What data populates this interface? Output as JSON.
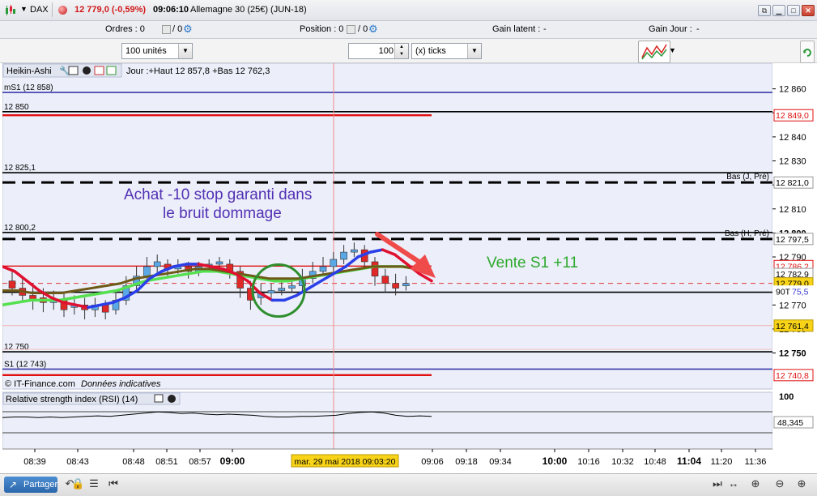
{
  "titlebar": {
    "symbol": "DAX",
    "price": "12 779,0 (-0,59%)",
    "time": "09:06:10",
    "instrument": "Allemagne 30 (25€) (JUN-18)"
  },
  "infobar": {
    "orders_label": "Ordres : 0",
    "orders_slash": "/ 0",
    "position_label": "Position : 0",
    "position_slash": "/ 0",
    "latent_label": "Gain latent :",
    "latent_value": "-",
    "day_label": "Gain Jour :",
    "day_value": "-"
  },
  "controls": {
    "quantity_value": "100 unités",
    "ticks_value": "100",
    "ticks_unit": "(x) ticks"
  },
  "panel_header": {
    "title": "Heikin-Ashi",
    "info": "Jour :+Haut 12 857,8 +Bas 12 762,3"
  },
  "chart_data": {
    "type": "candlestick",
    "ylim": [
      12735,
      12870
    ],
    "y_ticks": [
      "12 860",
      "12 850",
      "12 840",
      "12 830",
      "12 820",
      "12 810",
      "12 800",
      "12 790",
      "12 770",
      "12 760",
      "12 750"
    ],
    "level_lines": [
      {
        "label": "mS1 (12 858)",
        "value": 12858.5,
        "color": "#3a3aa8",
        "dash": false
      },
      {
        "label": "12 850",
        "value": 12850.5,
        "color": "#000000",
        "dash": false
      },
      {
        "label": "12 825,1",
        "value": 12825.1,
        "color": "#000000",
        "dash": false
      },
      {
        "label": "12 800,2",
        "value": 12800.2,
        "color": "#000000",
        "dash": false
      },
      {
        "label": "12 750",
        "value": 12750.5,
        "color": "#000000",
        "dash": false
      },
      {
        "label": "S1 (12 743)",
        "value": 12743.3,
        "color": "#3a3aa8",
        "dash": false
      },
      {
        "label": "",
        "value": 12821.0,
        "color": "#000000",
        "dash": true
      },
      {
        "label": "",
        "value": 12797.5,
        "color": "#000000",
        "dash": true
      },
      {
        "label": "",
        "value": 12775.3,
        "color": "#000000",
        "dash": false
      }
    ],
    "right_labels": [
      {
        "text": "Bas (J, Pré)",
        "value": 12821.0
      },
      {
        "text": "Bas (H, Pré)",
        "value": 12797.5
      }
    ],
    "price_tags": [
      {
        "text": "12 849,0",
        "value": 12849.0,
        "style": "red"
      },
      {
        "text": "12 821,0",
        "value": 12821.0,
        "style": "grey"
      },
      {
        "text": "12 797,5",
        "value": 12797.5,
        "style": "grey"
      },
      {
        "text": "12 786,2",
        "value": 12786.2,
        "style": "red"
      },
      {
        "text": "12 782,9",
        "value": 12782.9,
        "style": "grey"
      },
      {
        "text": "12 779,0",
        "value": 12779.0,
        "style": "yellow"
      },
      {
        "text": "90T",
        "value": 12775.6,
        "style": "blue"
      },
      {
        "text": "75,5",
        "value": 12775.6,
        "style": "blueval"
      },
      {
        "text": "12 761,4",
        "value": 12761.4,
        "style": "yellow"
      },
      {
        "text": "12 740,8",
        "value": 12740.8,
        "style": "red"
      }
    ],
    "candles": [
      {
        "o": 12780,
        "c": 12777,
        "h": 12784,
        "l": 12774
      },
      {
        "o": 12777,
        "c": 12774,
        "h": 12781,
        "l": 12771
      },
      {
        "o": 12774,
        "c": 12772,
        "h": 12779,
        "l": 12768
      },
      {
        "o": 12773,
        "c": 12771,
        "h": 12777,
        "l": 12767
      },
      {
        "o": 12771,
        "c": 12772,
        "h": 12776,
        "l": 12768
      },
      {
        "o": 12772,
        "c": 12768,
        "h": 12775,
        "l": 12765
      },
      {
        "o": 12769,
        "c": 12770,
        "h": 12774,
        "l": 12766
      },
      {
        "o": 12770,
        "c": 12768,
        "h": 12773,
        "l": 12764
      },
      {
        "o": 12768,
        "c": 12770,
        "h": 12773,
        "l": 12765
      },
      {
        "o": 12770,
        "c": 12767,
        "h": 12772,
        "l": 12764
      },
      {
        "o": 12768,
        "c": 12772,
        "h": 12776,
        "l": 12766
      },
      {
        "o": 12772,
        "c": 12778,
        "h": 12782,
        "l": 12770
      },
      {
        "o": 12778,
        "c": 12782,
        "h": 12786,
        "l": 12776
      },
      {
        "o": 12782,
        "c": 12786,
        "h": 12790,
        "l": 12780
      },
      {
        "o": 12786,
        "c": 12788,
        "h": 12791,
        "l": 12783
      },
      {
        "o": 12787,
        "c": 12785,
        "h": 12789,
        "l": 12782
      },
      {
        "o": 12785,
        "c": 12786,
        "h": 12789,
        "l": 12783
      },
      {
        "o": 12786,
        "c": 12784,
        "h": 12788,
        "l": 12781
      },
      {
        "o": 12784,
        "c": 12786,
        "h": 12788,
        "l": 12782
      },
      {
        "o": 12786,
        "c": 12787,
        "h": 12789,
        "l": 12784
      },
      {
        "o": 12787,
        "c": 12788,
        "h": 12790,
        "l": 12785
      },
      {
        "o": 12787,
        "c": 12784,
        "h": 12789,
        "l": 12781
      },
      {
        "o": 12784,
        "c": 12777,
        "h": 12786,
        "l": 12773
      },
      {
        "o": 12777,
        "c": 12772,
        "h": 12780,
        "l": 12768
      },
      {
        "o": 12773,
        "c": 12775,
        "h": 12779,
        "l": 12770
      },
      {
        "o": 12775,
        "c": 12776,
        "h": 12779,
        "l": 12773
      },
      {
        "o": 12776,
        "c": 12777,
        "h": 12780,
        "l": 12774
      },
      {
        "o": 12777,
        "c": 12778,
        "h": 12781,
        "l": 12775
      },
      {
        "o": 12778,
        "c": 12781,
        "h": 12785,
        "l": 12776
      },
      {
        "o": 12781,
        "c": 12784,
        "h": 12788,
        "l": 12779
      },
      {
        "o": 12784,
        "c": 12786,
        "h": 12790,
        "l": 12782
      },
      {
        "o": 12786,
        "c": 12789,
        "h": 12792,
        "l": 12784
      },
      {
        "o": 12789,
        "c": 12792,
        "h": 12795,
        "l": 12787
      },
      {
        "o": 12792,
        "c": 12793,
        "h": 12796,
        "l": 12790
      },
      {
        "o": 12793,
        "c": 12788,
        "h": 12795,
        "l": 12785
      },
      {
        "o": 12788,
        "c": 12782,
        "h": 12790,
        "l": 12778
      },
      {
        "o": 12782,
        "c": 12779,
        "h": 12785,
        "l": 12775
      },
      {
        "o": 12779,
        "c": 12777,
        "h": 12783,
        "l": 12774
      },
      {
        "o": 12778,
        "c": 12779,
        "h": 12782,
        "l": 12776
      }
    ],
    "ha_line": [
      12786,
      12784,
      12780,
      12776,
      12773,
      12771,
      12770,
      12769,
      12770,
      12771,
      12773,
      12776,
      12781,
      12784,
      12786,
      12787,
      12787,
      12786,
      12785,
      12783,
      12780,
      12775,
      12772,
      12772,
      12774,
      12777,
      12780,
      12783,
      12786,
      12790,
      12792,
      12793,
      12791,
      12787,
      12783,
      12780
    ],
    "green_line": [
      12770,
      12771,
      12772,
      12772,
      12772,
      12773,
      12774,
      12775,
      12776,
      12778,
      12780,
      12781,
      12782,
      12783,
      12784,
      12784,
      12783,
      12782,
      12781,
      12780,
      12780,
      12781,
      12782,
      12783,
      12784,
      12785,
      12786,
      12786,
      12786,
      12785,
      12784
    ],
    "olive_line": [
      12776,
      12776,
      12775,
      12775,
      12775,
      12776,
      12777,
      12778,
      12779,
      12781,
      12782,
      12783,
      12784,
      12785,
      12785,
      12784,
      12783,
      12782,
      12781,
      12781,
      12781,
      12782,
      12783,
      12784,
      12785,
      12786,
      12786,
      12786,
      12785,
      12784
    ],
    "annotation_left": [
      "Achat -10 stop garanti dans",
      "le bruit dommage"
    ],
    "annotation_right": "Vente S1 +11",
    "watermark": "© IT-Finance.com",
    "watermark2": "Données indicatives",
    "rsi": {
      "title": "Relative strength index (RSI) (14)",
      "top_label": "100",
      "value_label": "48,345",
      "values": [
        44,
        45,
        45,
        44,
        45,
        44,
        45,
        46,
        47,
        46,
        48,
        50,
        52,
        54,
        53,
        51,
        52,
        50,
        49,
        50,
        49,
        48,
        46,
        45,
        45,
        46,
        46,
        47,
        48,
        51,
        53,
        54,
        52,
        48,
        46,
        47,
        46
      ]
    },
    "x_ticks": [
      {
        "label": "08:39",
        "bold": false
      },
      {
        "label": "08:43",
        "bold": false
      },
      {
        "label": "08:48",
        "bold": false
      },
      {
        "label": "08:51",
        "bold": false
      },
      {
        "label": "08:57",
        "bold": false
      },
      {
        "label": "09:00",
        "bold": true
      },
      {
        "label": "09:06",
        "bold": false
      },
      {
        "label": "09:18",
        "bold": false
      },
      {
        "label": "09:34",
        "bold": false
      },
      {
        "label": "10:00",
        "bold": true
      },
      {
        "label": "10:16",
        "bold": false
      },
      {
        "label": "10:32",
        "bold": false
      },
      {
        "label": "10:48",
        "bold": false
      },
      {
        "label": "11:04",
        "bold": true
      },
      {
        "label": "11:20",
        "bold": false
      },
      {
        "label": "11:36",
        "bold": false
      }
    ],
    "cursor_label": "mar. 29 mai 2018 09:03:20"
  },
  "bottombar": {
    "share_label": "Partager"
  },
  "colors": {
    "accent": "#2b66ab",
    "bull": "#5aa8e6",
    "bear": "#e02828",
    "green_line": "#55e050",
    "olive_line": "#6d5a18",
    "ha_blue": "#2a3fe8",
    "ha_red": "#e01030",
    "annotation_purple": "#5230b4",
    "annotation_green": "#2ea82e"
  }
}
